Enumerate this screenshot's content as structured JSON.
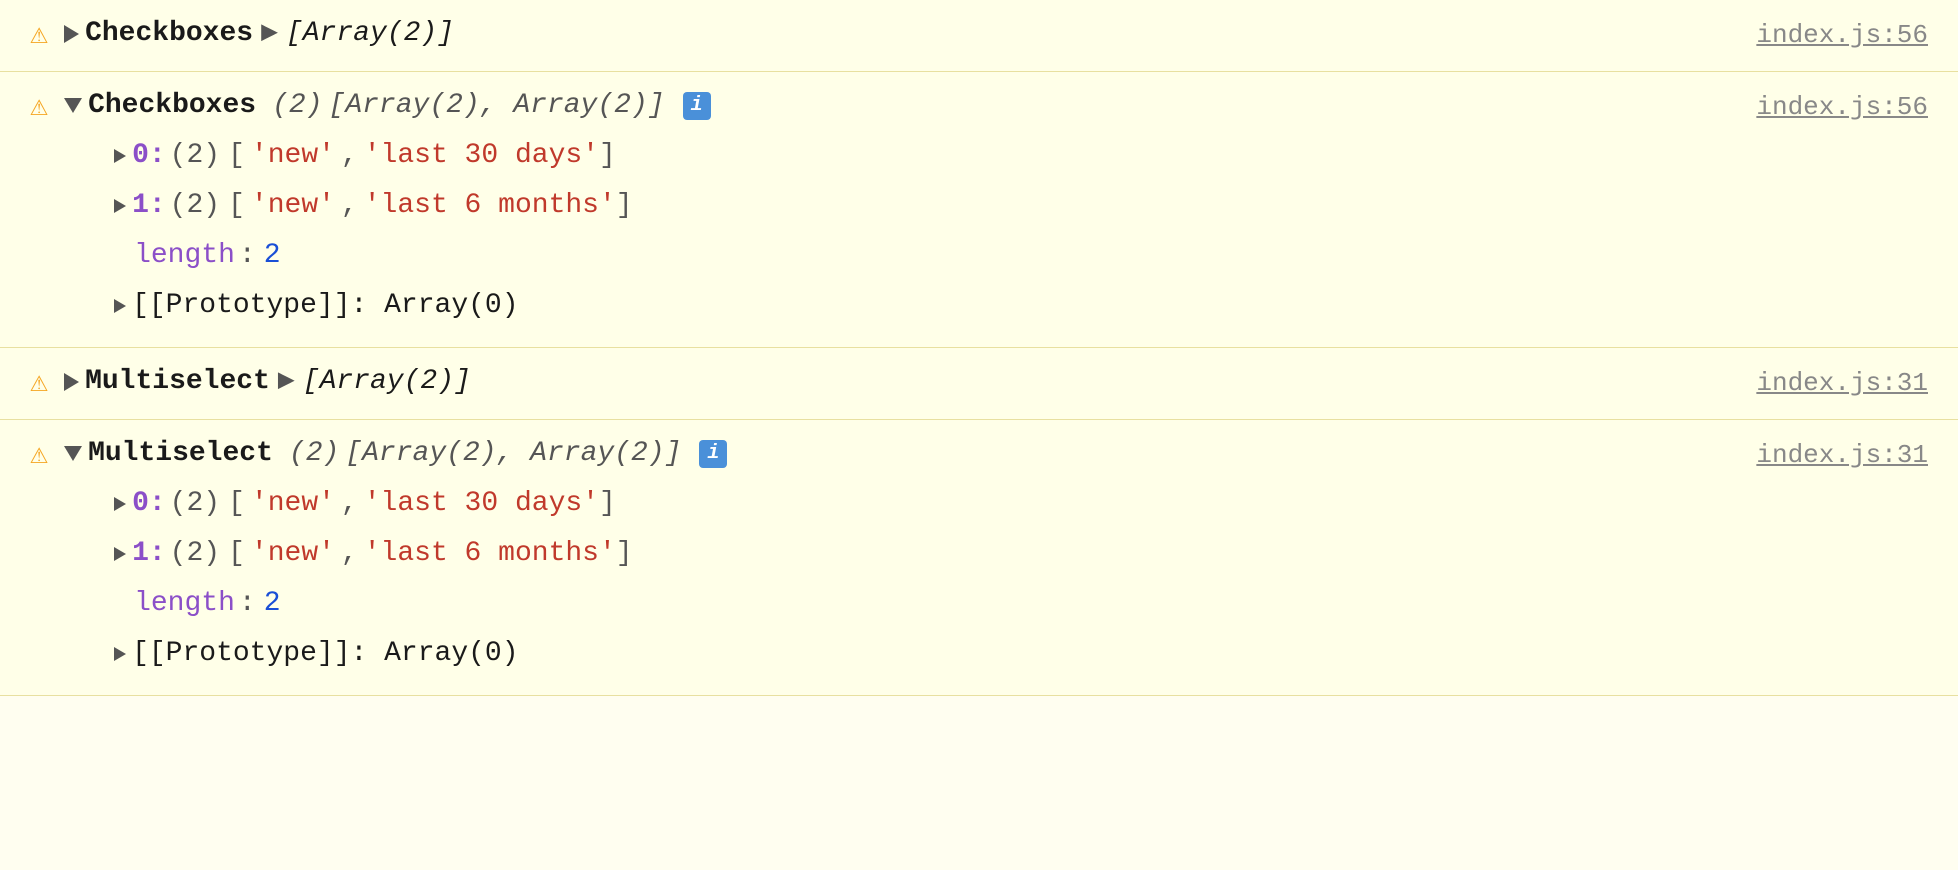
{
  "rows": [
    {
      "id": "row1",
      "warning": "⚠",
      "label": "Checkboxes",
      "expanded": false,
      "array_display": "[Array(2)]",
      "file_link": "index.js:56"
    },
    {
      "id": "row2",
      "warning": "⚠",
      "label": "Checkboxes",
      "expanded": true,
      "array_count": "(2)",
      "array_items": "[Array(2), Array(2)]",
      "has_info": true,
      "file_link": "index.js:56",
      "sub_items": [
        {
          "index": "0",
          "count": "(2)",
          "values": [
            "'new'",
            "'last 30 days'"
          ]
        },
        {
          "index": "1",
          "count": "(2)",
          "values": [
            "'new'",
            "'last 6 months'"
          ]
        }
      ],
      "length_label": "length",
      "length_value": "2",
      "prototype_label": "[[Prototype]]",
      "prototype_value": "Array(0)"
    },
    {
      "id": "row3",
      "warning": "⚠",
      "label": "Multiselect",
      "expanded": false,
      "array_display": "[Array(2)]",
      "file_link": "index.js:31"
    },
    {
      "id": "row4",
      "warning": "⚠",
      "label": "Multiselect",
      "expanded": true,
      "array_count": "(2)",
      "array_items": "[Array(2), Array(2)]",
      "has_info": true,
      "file_link": "index.js:31",
      "sub_items": [
        {
          "index": "0",
          "count": "(2)",
          "values": [
            "'new'",
            "'last 30 days'"
          ]
        },
        {
          "index": "1",
          "count": "(2)",
          "values": [
            "'new'",
            "'last 6 months'"
          ]
        }
      ],
      "length_label": "length",
      "length_value": "2",
      "prototype_label": "[[Prototype]]",
      "prototype_value": "Array(0)"
    }
  ],
  "icons": {
    "warning": "⚠",
    "info": "i"
  }
}
